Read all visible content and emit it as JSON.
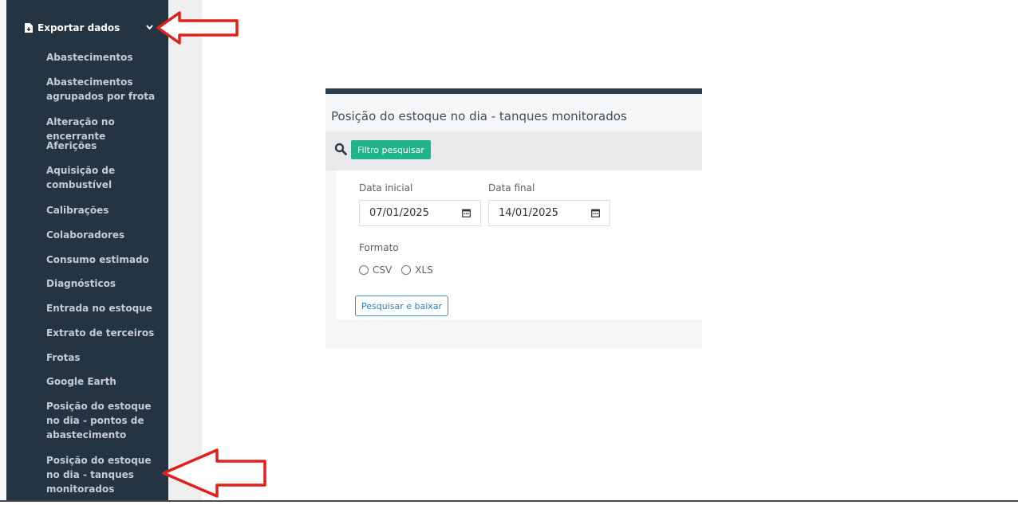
{
  "sidebar": {
    "header_label": "Exportar dados",
    "items": [
      "Abastecimentos",
      "Abastecimentos agrupados por frota",
      "Alteração no encerrante",
      "Aferições",
      "Aquisição de combustível",
      "Calibrações",
      "Colaboradores",
      "Consumo estimado",
      "Diagnósticos",
      "Entrada no estoque",
      "Extrato de terceiros",
      "Frotas",
      "Google Earth",
      "Posição do estoque no dia - pontos de abastecimento",
      "Posição do estoque no dia - tanques monitorados"
    ]
  },
  "card": {
    "title": "Posição do estoque no dia - tanques monitorados",
    "filter_button": "Filtro pesquisar",
    "start_label": "Data inicial",
    "start_value": "07/01/2025",
    "end_label": "Data final",
    "end_value": "14/01/2025",
    "format_label": "Formato",
    "option_csv": "CSV",
    "option_xls": "XLS",
    "submit_button": "Pesquisar e baixar"
  },
  "colors": {
    "sidebar_bg": "#253441",
    "accent_green": "#23b388",
    "annotation_red": "#e0201b",
    "link_blue": "#2a7fc6"
  }
}
